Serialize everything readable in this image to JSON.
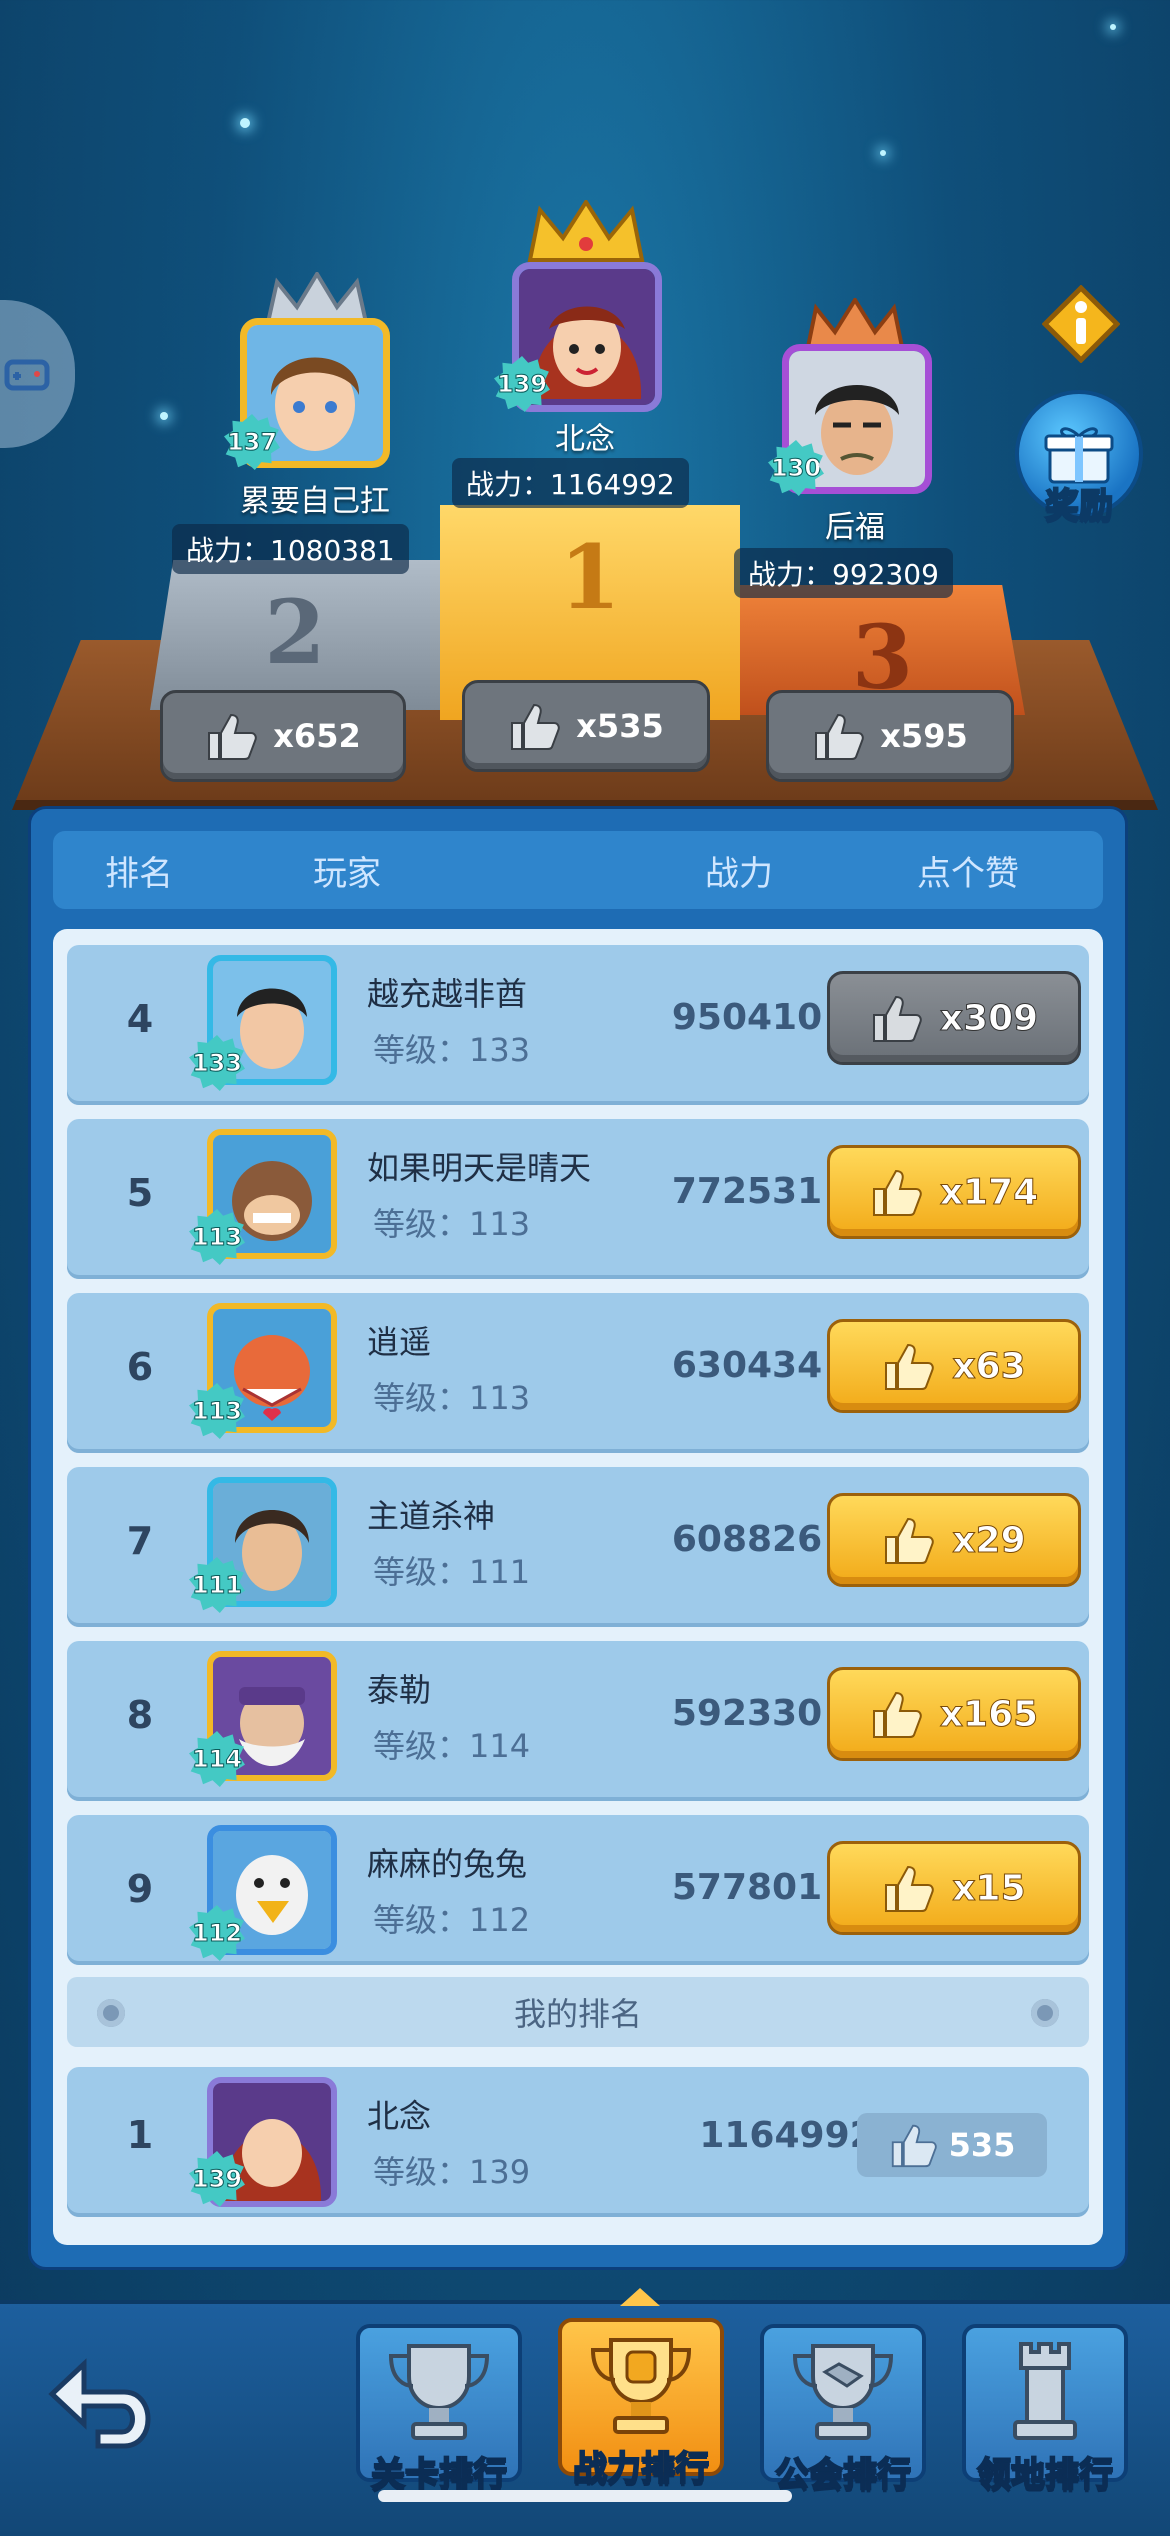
{
  "colors": {
    "gold": "#f2aa18",
    "panel": "#1e6cb4",
    "row": "#9ecaea",
    "teal_badge": "#44c9c4"
  },
  "side_tab": {
    "icon": "gamepad-icon"
  },
  "top_buttons": {
    "info_icon": "info-icon",
    "reward_label": "奖励",
    "reward_icon": "gift-icon"
  },
  "podium": {
    "first": {
      "rank": "1",
      "name": "北念",
      "level": "139",
      "power": "战力：1164992",
      "likes": "x535"
    },
    "second": {
      "rank": "2",
      "name": "累要自己扛",
      "level": "137",
      "power": "战力：1080381",
      "likes": "x652"
    },
    "third": {
      "rank": "3",
      "name": "后福",
      "level": "130",
      "power": "战力：992309",
      "likes": "x595"
    }
  },
  "list_header": {
    "rank": "排名",
    "player": "玩家",
    "power": "战力",
    "like": "点个赞"
  },
  "rows": [
    {
      "rank": "4",
      "name": "越充越非酋",
      "level_text": "等级：133",
      "level": "133",
      "power": "950410",
      "likes": "x309"
    },
    {
      "rank": "5",
      "name": "如果明天是晴天",
      "level_text": "等级：113",
      "level": "113",
      "power": "772531",
      "likes": "x174"
    },
    {
      "rank": "6",
      "name": "逍遥",
      "level_text": "等级：113",
      "level": "113",
      "power": "630434",
      "likes": "x63"
    },
    {
      "rank": "7",
      "name": "主道杀神",
      "level_text": "等级：111",
      "level": "111",
      "power": "608826",
      "likes": "x29"
    },
    {
      "rank": "8",
      "name": "泰勒",
      "level_text": "等级：114",
      "level": "114",
      "power": "592330",
      "likes": "x165"
    },
    {
      "rank": "9",
      "name": "麻麻的兔兔",
      "level_text": "等级：112",
      "level": "112",
      "power": "577801",
      "likes": "x15"
    }
  ],
  "my_rank": {
    "label": "我的排名",
    "rank": "1",
    "name": "北念",
    "level_text": "等级：139",
    "level": "139",
    "power": "1164992",
    "likes": "535"
  },
  "bottom_nav": {
    "back_icon": "back-arrow-icon",
    "tabs": [
      {
        "label": "关卡排行",
        "icon": "trophy-stage-icon"
      },
      {
        "label": "战力排行",
        "icon": "trophy-fist-icon",
        "active": true
      },
      {
        "label": "公会排行",
        "icon": "trophy-handshake-icon"
      },
      {
        "label": "领地排行",
        "icon": "trophy-tower-icon"
      }
    ]
  }
}
